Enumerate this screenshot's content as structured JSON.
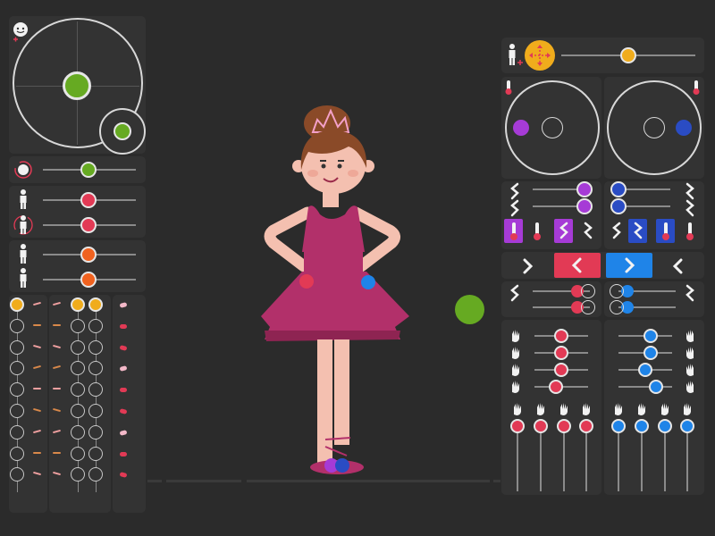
{
  "app": {
    "name": "character-rig-controls"
  },
  "colors": {
    "background": "#2b2b2b",
    "panel": "#333333",
    "green": "#66aa22",
    "red": "#e23a55",
    "orange": "#f0621f",
    "yellow": "#f0ac1c",
    "purple": "#a63bd6",
    "navy": "#2a4cc4",
    "blue": "#1f84e8",
    "skin": "#f4c0b0",
    "dress": "#b2306a"
  },
  "left_panel": {
    "head_icon": "face-icon",
    "pose_pad": {
      "knob_color": "green"
    },
    "sliders": [
      {
        "icon": "face-rotate-icon",
        "color": "green",
        "value": 0.5
      },
      {
        "icon": "body-icon",
        "color": "red",
        "value": 0.5
      },
      {
        "icon": "body-rotate-icon",
        "color": "red",
        "value": 0.5
      },
      {
        "icon": "body-icon",
        "color": "orange",
        "value": 0.5
      },
      {
        "icon": "body-icon",
        "color": "orange",
        "value": 0.5
      }
    ],
    "expression_columns": [
      "eyes",
      "brows",
      "mouth"
    ]
  },
  "right_panel": {
    "top": {
      "icon": "figure-add-icon",
      "dial": "move-icon",
      "slider_value": 0.62
    },
    "eye_pads": [
      {
        "color": "purple"
      },
      {
        "color": "navy"
      }
    ],
    "left_sliders": [
      "purple",
      "purple"
    ],
    "right_sliders": [
      "navy",
      "navy"
    ],
    "arrow_buttons": [
      "chevron-right-icon",
      "chevron-left-icon",
      "chevron-right-icon",
      "chevron-left-icon"
    ],
    "hand_sliders_left": {
      "color": "red",
      "count": 4
    },
    "hand_sliders_right": {
      "color": "blue",
      "count": 4
    },
    "finger_sliders_left": {
      "color": "red",
      "count": 4
    },
    "finger_sliders_right": {
      "color": "blue",
      "count": 4
    }
  },
  "stage": {
    "character": "ballerina-character",
    "floating_target": "green"
  }
}
